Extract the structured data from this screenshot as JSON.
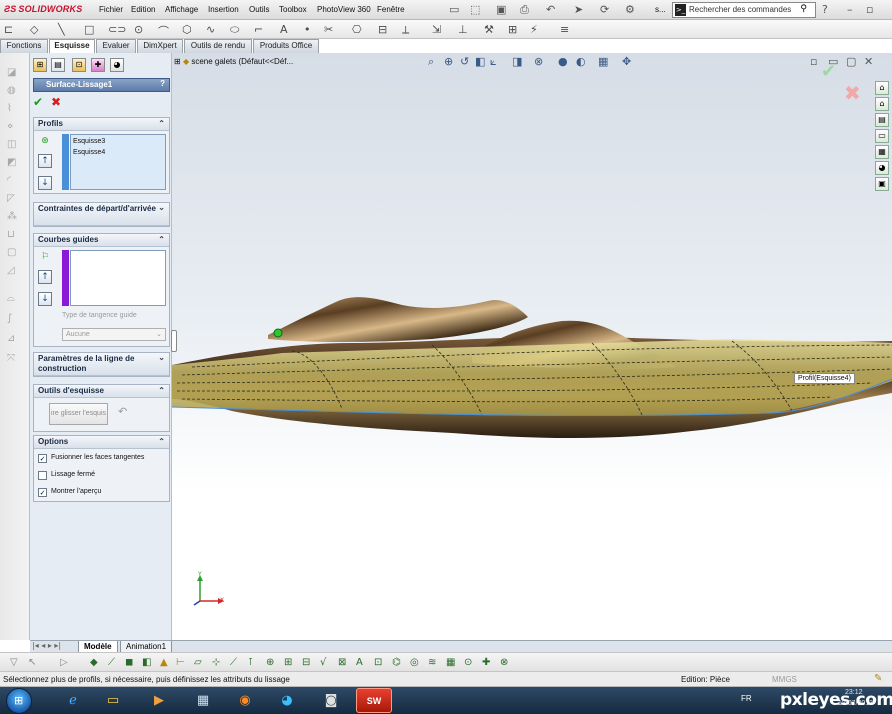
{
  "app": {
    "brand": "SOLIDWORKS",
    "menu": [
      "Fichier",
      "Edition",
      "Affichage",
      "Insertion",
      "Outils",
      "Toolbox",
      "PhotoView 360",
      "Fenêtre"
    ],
    "menu_truncated": "s...",
    "search_placeholder": "Rechercher des commandes"
  },
  "tabs": [
    "Fonctions",
    "Esquisse",
    "Evaluer",
    "DimXpert",
    "Outils de rendu",
    "Produits Office"
  ],
  "active_tab": "Esquisse",
  "feature_tree": {
    "label": "scene galets  (Défaut<<Déf..."
  },
  "property_manager": {
    "title": "Surface-Lissage1",
    "help": "?",
    "groups": {
      "profils": {
        "title": "Profils",
        "items": [
          "Esquisse3",
          "Esquisse4"
        ]
      },
      "contraintes": {
        "title": "Contraintes de départ/d'arrivée"
      },
      "courbes": {
        "title": "Courbes guides",
        "tangency_label": "Type de tangence guide",
        "tangency_value": "Aucune"
      },
      "parametres": {
        "title": "Paramètres de la ligne de construction"
      },
      "outils": {
        "title": "Outils d'esquisse",
        "drag_button": "ire glisser l'esquis"
      },
      "options": {
        "title": "Options",
        "checkboxes": [
          {
            "label": "Fusionner les faces tangentes",
            "checked": true
          },
          {
            "label": "Lissage fermé",
            "checked": false
          },
          {
            "label": "Montrer l'aperçu",
            "checked": true
          }
        ]
      }
    }
  },
  "viewport": {
    "callout": "Profil(Esquisse4)",
    "triad": {
      "x": "X",
      "y": "Y"
    }
  },
  "bottom_tabs": [
    "Modèle",
    "Animation1"
  ],
  "active_bottom_tab": "Modèle",
  "status": {
    "message": "Sélectionnez plus de profils, si nécessaire, puis définissez les attributs du lissage",
    "mode": "Edition: Pièce",
    "units": "MMGS"
  },
  "taskbar": {
    "sw_label": "SW",
    "lang": "FR",
    "time": "23:12",
    "date": "18/07/2013"
  },
  "watermark": "pxleyes.com",
  "colors": {
    "accent_head": "#5c7ba8",
    "profile_bar": "#4a90d8",
    "guide_bar": "#8a1ad8",
    "ok": "#1a9a1a",
    "cancel": "#d42020"
  }
}
